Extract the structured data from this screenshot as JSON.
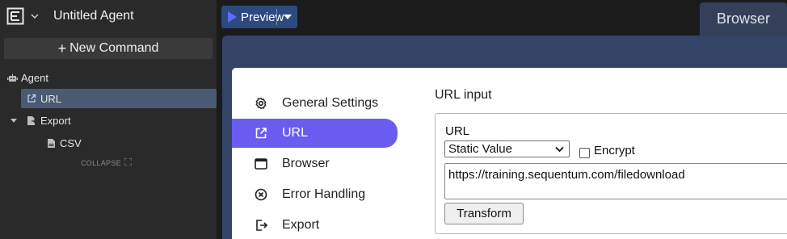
{
  "app": {
    "agent_title": "Untitled Agent",
    "new_command_label": "New Command"
  },
  "tree": {
    "agent": "Agent",
    "url": "URL",
    "export": "Export",
    "csv": "CSV",
    "collapse": "COLLAPSE"
  },
  "topbar": {
    "preview_label": "Preview",
    "browser_tab": "Browser"
  },
  "menu": {
    "items": [
      {
        "label": "General Settings",
        "icon": "gear-icon"
      },
      {
        "label": "URL",
        "icon": "external-link-icon",
        "active": true
      },
      {
        "label": "Browser",
        "icon": "window-icon"
      },
      {
        "label": "Error Handling",
        "icon": "circle-x-icon"
      },
      {
        "label": "Export",
        "icon": "export-icon"
      }
    ]
  },
  "url_panel": {
    "section_title": "URL input",
    "field_label": "URL",
    "value_type": "Static Value",
    "encrypt_label": "Encrypt",
    "encrypt_checked": false,
    "url_value": "https://training.sequentum.com/filedownload",
    "transform_label": "Transform"
  },
  "colors": {
    "accent": "#6a5cf0",
    "selected_tree": "#4a5a73",
    "preview_btn": "#2d4a7e",
    "band": "#334466"
  }
}
